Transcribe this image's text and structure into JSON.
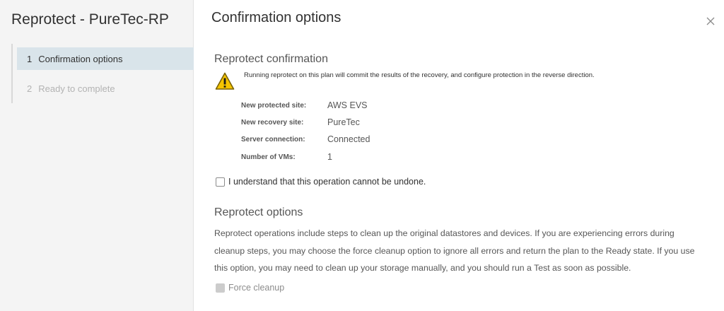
{
  "wizard": {
    "title": "Reprotect - PureTec-RP",
    "steps": [
      {
        "number": "1",
        "label": "Confirmation options",
        "state": "active"
      },
      {
        "number": "2",
        "label": "Ready to complete",
        "state": "inactive"
      }
    ]
  },
  "page": {
    "title": "Confirmation options",
    "close_icon": "close-icon"
  },
  "confirmation": {
    "title": "Reprotect confirmation",
    "warning_icon": "warning-icon",
    "warning_text": "Running reprotect on this plan will commit the results of the recovery, and configure protection in the reverse direction.",
    "details": [
      {
        "label": "New protected site:",
        "value": "AWS EVS"
      },
      {
        "label": "New recovery site:",
        "value": "PureTec"
      },
      {
        "label": "Server connection:",
        "value": "Connected"
      },
      {
        "label": "Number of VMs:",
        "value": "1"
      }
    ],
    "understand_label": "I understand that this operation cannot be undone."
  },
  "options": {
    "title": "Reprotect options",
    "description": "Reprotect operations include steps to clean up the original datastores and devices. If you are experiencing errors during cleanup steps, you may choose the force cleanup option to ignore all errors and return the plan to the Ready state. If you use this option, you may need to clean up your storage manually, and you should run a Test as soon as possible.",
    "force_cleanup_label": "Force cleanup"
  },
  "colors": {
    "active_step_bg": "#d9e4ea",
    "warning_yellow": "#f5c400"
  }
}
